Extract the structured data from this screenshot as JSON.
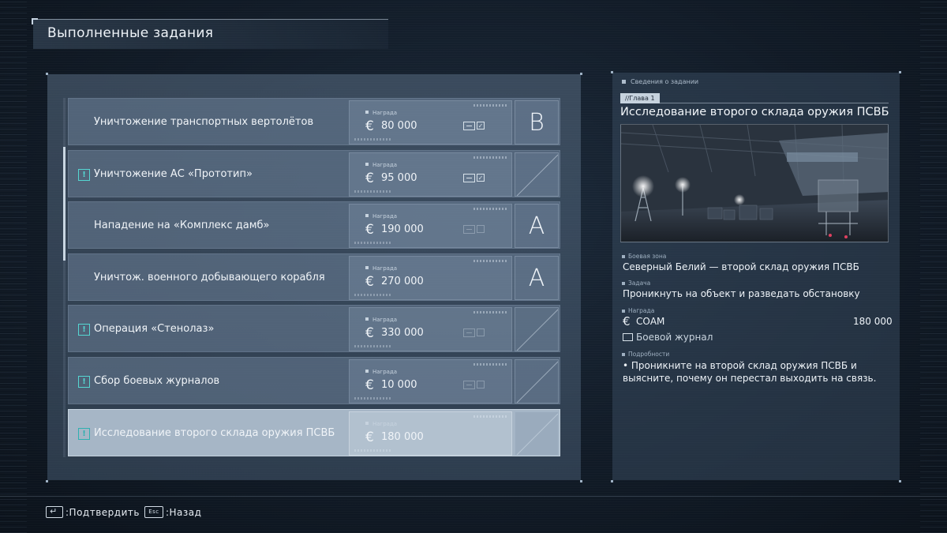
{
  "header": {
    "title": "Выполненные задания"
  },
  "missions": [
    {
      "name": "Уничтожение транспортных вертолётов",
      "alert": false,
      "reward_label": "Награда",
      "currency": "€",
      "reward": "80 000",
      "log_collected": true,
      "grade": "B",
      "selected": false
    },
    {
      "name": "Уничтожение АС «Прототип»",
      "alert": true,
      "reward_label": "Награда",
      "currency": "€",
      "reward": "95 000",
      "log_collected": true,
      "grade": "",
      "selected": false
    },
    {
      "name": "Нападение на «Комплекс дамб»",
      "alert": false,
      "reward_label": "Награда",
      "currency": "€",
      "reward": "190 000",
      "log_collected": false,
      "grade": "A",
      "selected": false
    },
    {
      "name": "Уничтож. военного добывающего корабля",
      "alert": false,
      "reward_label": "Награда",
      "currency": "€",
      "reward": "270 000",
      "log_collected": null,
      "grade": "A",
      "selected": false
    },
    {
      "name": "Операция «Стенолаз»",
      "alert": true,
      "reward_label": "Награда",
      "currency": "€",
      "reward": "330 000",
      "log_collected": false,
      "grade": "",
      "selected": false
    },
    {
      "name": "Сбор боевых журналов",
      "alert": true,
      "reward_label": "Награда",
      "currency": "€",
      "reward": "10 000",
      "log_collected": false,
      "grade": "",
      "selected": false
    },
    {
      "name": "Исследование второго склада оружия ПСВБ",
      "alert": true,
      "reward_label": "Награда",
      "currency": "€",
      "reward": "180 000",
      "log_collected": null,
      "grade": "",
      "selected": true
    }
  ],
  "details": {
    "section_label": "Сведения о задании",
    "chapter": "//Глава 1",
    "title": "Исследование второго склада оружия ПСВБ",
    "combat_zone_label": "Боевая зона",
    "combat_zone": "Северный Белий — второй склад оружия ПСВБ",
    "task_label": "Задача",
    "task": "Проникнуть на объект и разведать обстановку",
    "reward_label": "Награда",
    "reward_currency": "€",
    "reward_source": "СОАМ",
    "reward_amount": "180 000",
    "combat_log": "Боевой журнал",
    "details_label": "Подробности",
    "details_text": "• Проникните на второй склад оружия ПСВБ и выясните, почему он перестал выходить на связь."
  },
  "footer": {
    "confirm": ":Подтвердить",
    "esc_key": "Esc",
    "back": ":Назад"
  },
  "colors": {
    "accent_alert": "#55d6d2",
    "selected_row": "#a6b6c6"
  }
}
